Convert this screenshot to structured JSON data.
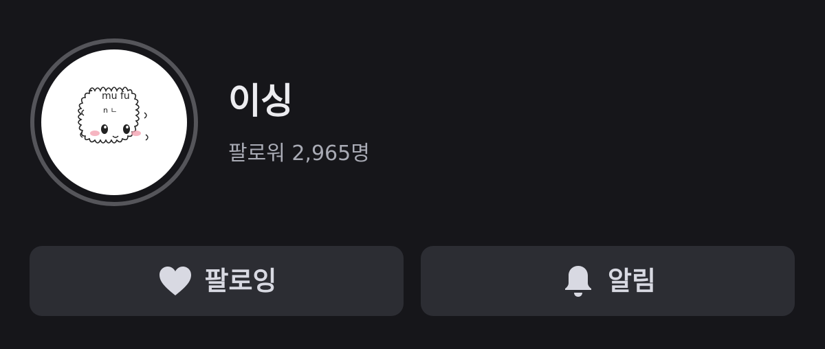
{
  "profile": {
    "name": "이싱",
    "followers_text": "팔로워 2,965명",
    "avatar_icon": "fluffy-creature-avatar",
    "avatar_text": "mu fu\nn ㄴ"
  },
  "actions": {
    "follow_label": "팔로잉",
    "follow_icon": "heart-icon",
    "notify_label": "알림",
    "notify_icon": "bell-icon"
  },
  "colors": {
    "background": "#16161a",
    "button_bg": "#2c2d33",
    "text_primary": "#ececf0",
    "text_secondary": "#a9abb5",
    "icon_fill": "#d8d9e2"
  }
}
